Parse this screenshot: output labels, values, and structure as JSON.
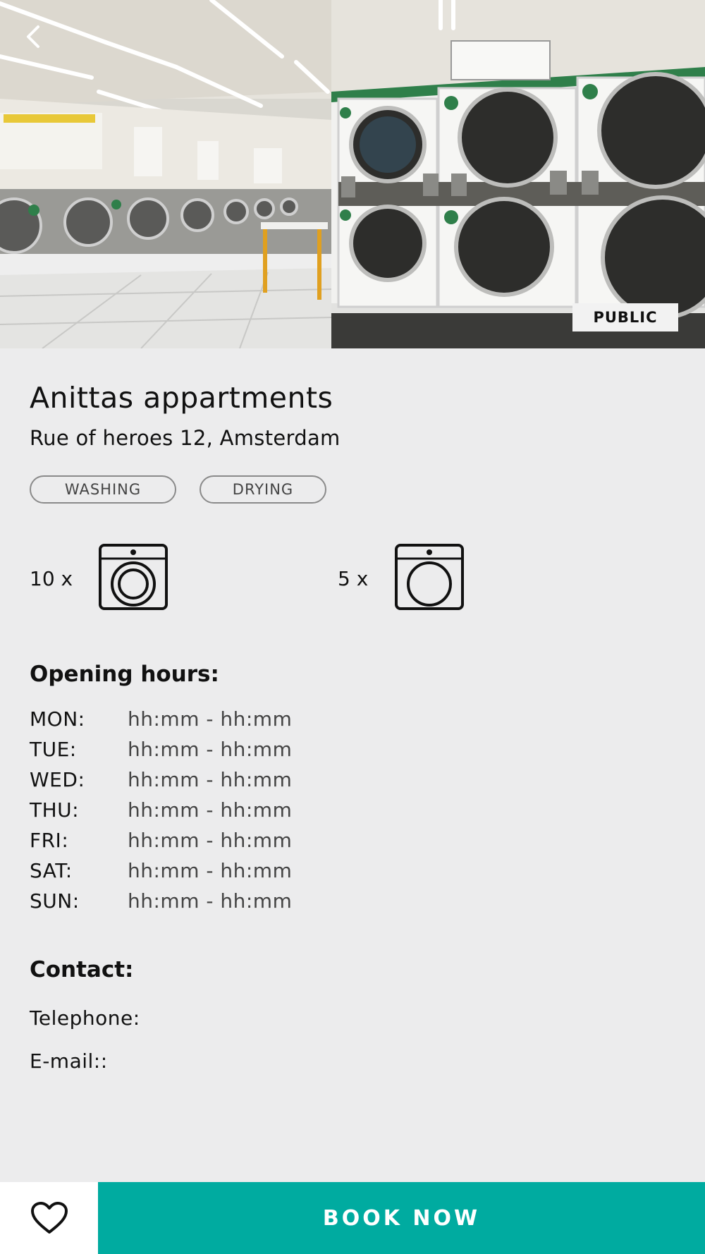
{
  "hero": {
    "badge": "PUBLIC",
    "back_icon": "chevron-left-icon"
  },
  "location": {
    "name": "Anittas appartments",
    "address": "Rue of heroes 12, Amsterdam"
  },
  "tags": [
    "WASHING",
    "DRYING"
  ],
  "machines": {
    "washers": {
      "count_label": "10 x",
      "icon": "washing-machine-icon"
    },
    "dryers": {
      "count_label": "5 x",
      "icon": "dryer-icon"
    }
  },
  "opening_hours": {
    "title": "Opening hours:",
    "rows": [
      {
        "day": "MON:",
        "time": "hh:mm - hh:mm"
      },
      {
        "day": "TUE:",
        "time": "hh:mm - hh:mm"
      },
      {
        "day": "WED:",
        "time": "hh:mm - hh:mm"
      },
      {
        "day": "THU:",
        "time": "hh:mm - hh:mm"
      },
      {
        "day": "FRI:",
        "time": "hh:mm - hh:mm"
      },
      {
        "day": "SAT:",
        "time": "hh:mm - hh:mm"
      },
      {
        "day": "SUN:",
        "time": "hh:mm - hh:mm"
      }
    ]
  },
  "contact": {
    "title": "Contact:",
    "telephone_label": "Telephone:",
    "email_label": "E-mail::"
  },
  "footer": {
    "favorite_icon": "heart-icon",
    "book_label": "BOOK NOW"
  },
  "colors": {
    "accent": "#00aba0",
    "background": "#ececed"
  }
}
